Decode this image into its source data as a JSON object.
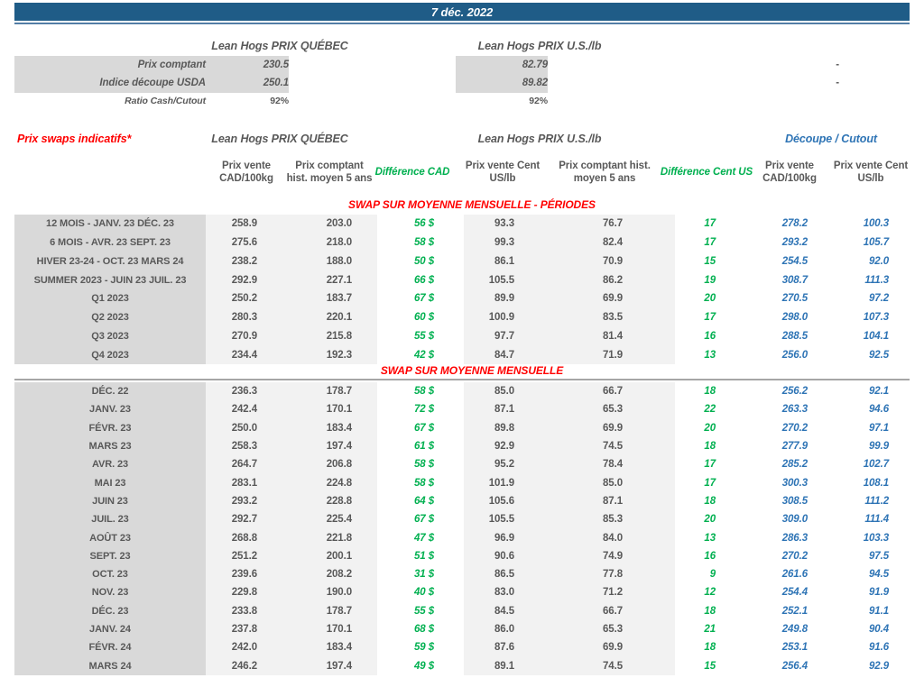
{
  "banner": {
    "date": "7 déc. 2022"
  },
  "colors": {
    "banner_blue": "#1F5C87",
    "accent_red": "#FF0000",
    "accent_green": "#00B050",
    "accent_blue": "#2E74B5",
    "text_dark": "#595959",
    "band_dark": "#D9D9D9",
    "band_light": "#F2F2F2"
  },
  "summary": {
    "quebec_title": "Lean Hogs PRIX QUÉBEC",
    "us_title": "Lean Hogs PRIX U.S./lb",
    "rows": [
      {
        "label": "Prix comptant",
        "quebec": "230.5",
        "us": "82.79",
        "cutout": "-"
      },
      {
        "label": "Indice découpe USDA",
        "quebec": "250.1",
        "us": "89.82",
        "cutout": "-"
      },
      {
        "label": "Ratio Cash/Cutout",
        "quebec": "92%",
        "us": "92%",
        "cutout": ""
      }
    ]
  },
  "swaps": {
    "title": "Prix swaps indicatifs*",
    "quebec_title": "Lean Hogs PRIX QUÉBEC",
    "us_title": "Lean Hogs PRIX U.S./lb",
    "cutout_title": "Découpe / Cutout",
    "column_headers": [
      "Prix vente CAD/100kg",
      "Prix comptant hist. moyen 5 ans",
      "Différence CAD",
      "Prix vente Cent US/lb",
      "Prix comptant hist. moyen 5 ans",
      "Différence Cent US",
      "Prix vente CAD/100kg",
      "Prix vente Cent US/lb"
    ]
  },
  "sections": [
    {
      "title": "SWAP SUR MOYENNE MENSUELLE - PÉRIODES",
      "rows": [
        [
          "12 MOIS - JANV. 23 DÉC. 23",
          "258.9",
          "203.0",
          "56 $",
          "93.3",
          "76.7",
          "17",
          "278.2",
          "100.3"
        ],
        [
          "6 MOIS - AVR. 23 SEPT. 23",
          "275.6",
          "218.0",
          "58 $",
          "99.3",
          "82.4",
          "17",
          "293.2",
          "105.7"
        ],
        [
          "HIVER 23-24 - OCT. 23 MARS 24",
          "238.2",
          "188.0",
          "50 $",
          "86.1",
          "70.9",
          "15",
          "254.5",
          "92.0"
        ],
        [
          "SUMMER 2023 - JUIN 23 JUIL. 23",
          "292.9",
          "227.1",
          "66 $",
          "105.5",
          "86.2",
          "19",
          "308.7",
          "111.3"
        ],
        [
          "Q1 2023",
          "250.2",
          "183.7",
          "67 $",
          "89.9",
          "69.9",
          "20",
          "270.5",
          "97.2"
        ],
        [
          "Q2 2023",
          "280.3",
          "220.1",
          "60 $",
          "100.9",
          "83.5",
          "17",
          "298.0",
          "107.3"
        ],
        [
          "Q3 2023",
          "270.9",
          "215.8",
          "55 $",
          "97.7",
          "81.4",
          "16",
          "288.5",
          "104.1"
        ],
        [
          "Q4 2023",
          "234.4",
          "192.3",
          "42 $",
          "84.7",
          "71.9",
          "13",
          "256.0",
          "92.5"
        ]
      ]
    },
    {
      "title": "SWAP SUR MOYENNE MENSUELLE",
      "rows": [
        [
          "DÉC. 22",
          "236.3",
          "178.7",
          "58 $",
          "85.0",
          "66.7",
          "18",
          "256.2",
          "92.1"
        ],
        [
          "JANV. 23",
          "242.4",
          "170.1",
          "72 $",
          "87.1",
          "65.3",
          "22",
          "263.3",
          "94.6"
        ],
        [
          "FÉVR. 23",
          "250.0",
          "183.4",
          "67 $",
          "89.8",
          "69.9",
          "20",
          "270.2",
          "97.1"
        ],
        [
          "MARS 23",
          "258.3",
          "197.4",
          "61 $",
          "92.9",
          "74.5",
          "18",
          "277.9",
          "99.9"
        ],
        [
          "AVR. 23",
          "264.7",
          "206.8",
          "58 $",
          "95.2",
          "78.4",
          "17",
          "285.2",
          "102.7"
        ],
        [
          "MAI 23",
          "283.1",
          "224.8",
          "58 $",
          "101.9",
          "85.0",
          "17",
          "300.3",
          "108.1"
        ],
        [
          "JUIN 23",
          "293.2",
          "228.8",
          "64 $",
          "105.6",
          "87.1",
          "18",
          "308.5",
          "111.2"
        ],
        [
          "JUIL. 23",
          "292.7",
          "225.4",
          "67 $",
          "105.5",
          "85.3",
          "20",
          "309.0",
          "111.4"
        ],
        [
          "AOÛT 23",
          "268.8",
          "221.8",
          "47 $",
          "96.9",
          "84.0",
          "13",
          "286.3",
          "103.3"
        ],
        [
          "SEPT. 23",
          "251.2",
          "200.1",
          "51 $",
          "90.6",
          "74.9",
          "16",
          "270.2",
          "97.5"
        ],
        [
          "OCT. 23",
          "239.6",
          "208.2",
          "31 $",
          "86.5",
          "77.8",
          "9",
          "261.6",
          "94.5"
        ],
        [
          "NOV. 23",
          "229.8",
          "190.0",
          "40 $",
          "83.0",
          "71.2",
          "12",
          "254.4",
          "91.9"
        ],
        [
          "DÉC. 23",
          "233.8",
          "178.7",
          "55 $",
          "84.5",
          "66.7",
          "18",
          "252.1",
          "91.1"
        ],
        [
          "JANV. 24",
          "237.8",
          "170.1",
          "68 $",
          "86.0",
          "65.3",
          "21",
          "249.8",
          "90.4"
        ],
        [
          "FÉVR. 24",
          "242.0",
          "183.4",
          "59 $",
          "87.6",
          "69.9",
          "18",
          "253.1",
          "91.6"
        ],
        [
          "MARS 24",
          "246.2",
          "197.4",
          "49 $",
          "89.1",
          "74.5",
          "15",
          "256.4",
          "92.9"
        ]
      ]
    }
  ]
}
